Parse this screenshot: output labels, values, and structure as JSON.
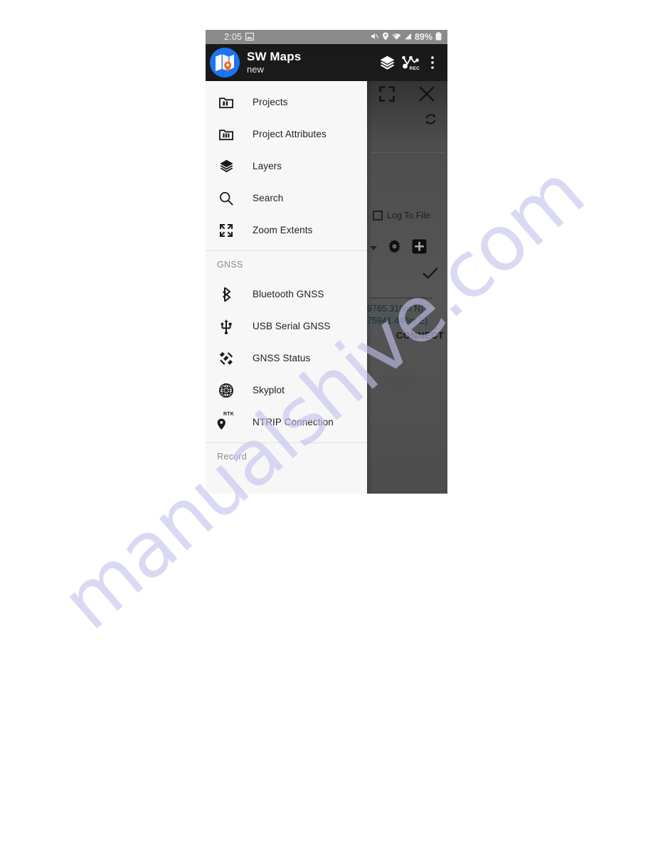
{
  "watermark": {
    "text": "manualshive.com"
  },
  "status_bar": {
    "time": "2:05",
    "battery_percent": "89%",
    "icons": [
      "screenshot-icon",
      "mute-icon",
      "location-icon",
      "wifi-icon",
      "cellular-signal-icon",
      "battery-icon"
    ]
  },
  "app_bar": {
    "logo_name": "sw-maps-logo",
    "title": "SW Maps",
    "subtitle": "new",
    "actions": [
      {
        "name": "layers-icon",
        "label": ""
      },
      {
        "name": "record-track-icon",
        "label": "REC"
      },
      {
        "name": "overflow-menu-icon",
        "label": ""
      }
    ]
  },
  "drawer": {
    "items": [
      {
        "label": "Projects",
        "icon": "projects-icon"
      },
      {
        "label": "Project Attributes",
        "icon": "project-attributes-icon"
      },
      {
        "label": "Layers",
        "icon": "layers-icon"
      },
      {
        "label": "Search",
        "icon": "search-icon"
      },
      {
        "label": "Zoom Extents",
        "icon": "zoom-extents-icon"
      }
    ],
    "gnss_section_title": "GNSS",
    "gnss_items": [
      {
        "label": "Bluetooth GNSS",
        "icon": "bluetooth-icon"
      },
      {
        "label": "USB Serial GNSS",
        "icon": "usb-icon"
      },
      {
        "label": "GNSS Status",
        "icon": "satellite-icon"
      },
      {
        "label": "Skyplot",
        "icon": "skyplot-globe-icon"
      },
      {
        "label": "NTRIP Connection",
        "icon": "rtk-pin-icon",
        "icon_badge": "RTK"
      }
    ],
    "record_section_title": "Record"
  },
  "panel": {
    "fullscreen_icon": "fullscreen-crop-icon",
    "close_icon": "close-icon",
    "refresh_icon": "refresh-icon",
    "log_to_file_label": "Log To File",
    "log_to_file_checked": false,
    "dropdown_icon": "chevron-down-icon",
    "settings_icon": "gear-icon",
    "add_icon": "add-square-icon",
    "confirm_icon": "check-icon",
    "coordinate_north": "9765.310m N)",
    "coordinate_east": "75941.446m E)",
    "connect_label": "CONNECT"
  },
  "colors": {
    "accent_blue": "#1b74f2",
    "pin_orange": "#f26b21",
    "coordinate_teal": "#14484b",
    "drawer_bg": "#f7f7f7",
    "watermark": "#c5c3ee"
  }
}
